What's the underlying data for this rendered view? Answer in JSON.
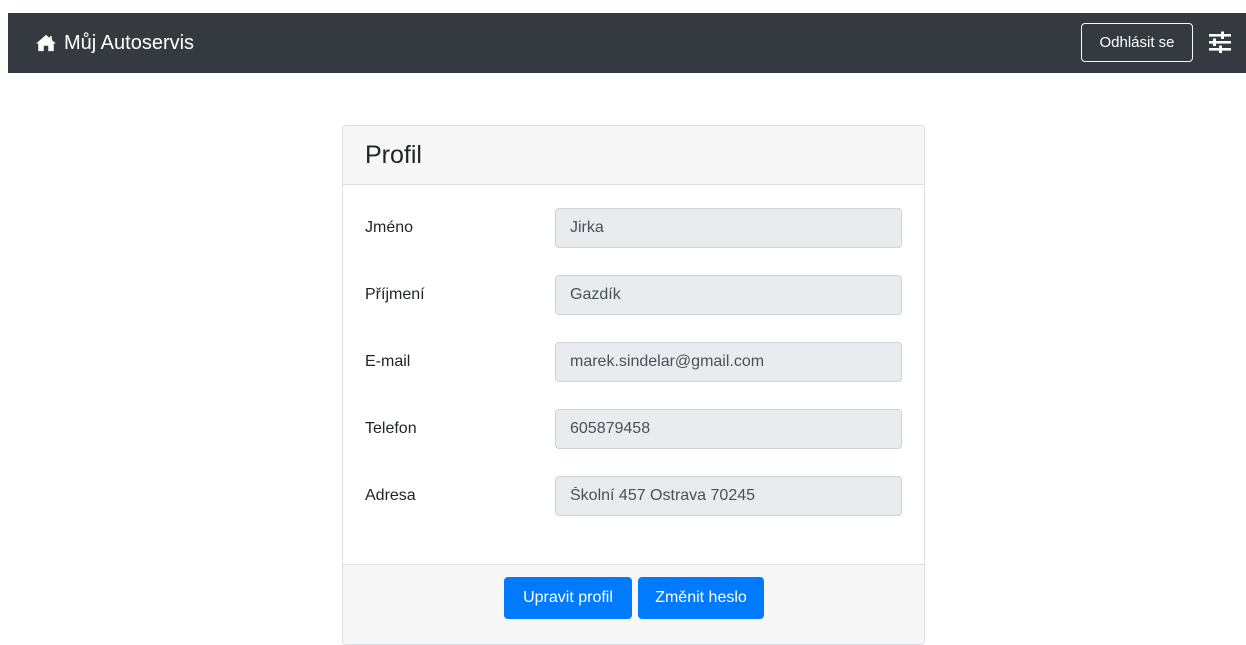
{
  "navbar": {
    "brand": "Můj Autoservis",
    "brand_icon": "home-icon",
    "logout_label": "Odhlásit se",
    "settings_icon": "sliders-icon",
    "background": "#343a40"
  },
  "profile": {
    "title": "Profil",
    "fields": [
      {
        "label": "Jméno",
        "value": "Jirka"
      },
      {
        "label": "Příjmení",
        "value": "Gazdík"
      },
      {
        "label": "E-mail",
        "value": "marek.sindelar@gmail.com"
      },
      {
        "label": "Telefon",
        "value": "605879458"
      },
      {
        "label": "Adresa",
        "value": "Školní 457 Ostrava 70245"
      }
    ],
    "edit_button": "Upravit profil",
    "change_password_button": "Změnit heslo",
    "primary_color": "#007bff",
    "field_background": "#e9ecef"
  }
}
